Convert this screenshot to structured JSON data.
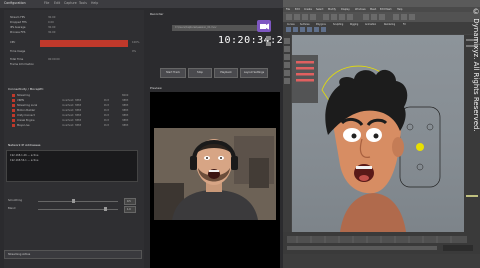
{
  "recorder_app": {
    "window_title": "Configuration",
    "tabs": [
      "File",
      "Edit",
      "Capture",
      "Tools",
      "Help"
    ],
    "config_rows": [
      {
        "label": "Stream FPS",
        "value": "30.00"
      },
      {
        "label": "Dropped FPS",
        "value": "0.00"
      },
      {
        "label": "IPS Average",
        "value": "30.00"
      },
      {
        "label": "Process FPS",
        "value": "30.00"
      },
      {
        "label": "CPU",
        "value": "100%"
      },
      {
        "label": "Time Usage",
        "value": "0%"
      },
      {
        "label": "Total Time",
        "value": "00:00:00"
      },
      {
        "label": "Frame Information",
        "value": ""
      }
    ],
    "cpu_percent": 100,
    "streaming_header": "Connectivity / MocapPC",
    "services": [
      {
        "name": "Streaming",
        "addr": "",
        "proto": "Port",
        "port": "8000"
      },
      {
        "name": "VRPN",
        "addr": "localhost: 3883",
        "proto": "Port",
        "port": "3883"
      },
      {
        "name": "Streaming Local",
        "addr": "localhost: 3883",
        "proto": "Port",
        "port": "3883"
      },
      {
        "name": "Motion Builder",
        "addr": "localhost: 3883",
        "proto": "Port",
        "port": "3883"
      },
      {
        "name": "Unity Connect",
        "addr": "localhost: 3883",
        "proto": "Port",
        "port": "3883"
      },
      {
        "name": "Unreal Engine",
        "addr": "localhost: 3883",
        "proto": "Port",
        "port": "3883"
      },
      {
        "name": "Maya Live",
        "addr": "localhost: 3883",
        "proto": "Port",
        "port": "3883"
      }
    ],
    "ip_header": "Network IP Addresses",
    "ip_lines": [
      "192.168.1.46  —  active",
      "192.168.56.1  —  active"
    ],
    "smoothing_label": "Smoothing",
    "smoothing_value": "0.5",
    "blend_label": "Blend",
    "blend_value": "1.0",
    "bottom_status": "Streaming Active",
    "recorder_label": "Recorder",
    "recorder_path": "C:\\Users\\Captures\\session_01.mov",
    "timecode": "10:20:34:23",
    "buttons": {
      "rec": "Start Track",
      "stop": "Stop",
      "prev": "Playback",
      "settings": "Layout Settings"
    },
    "preview_label": "Preview",
    "icons": {
      "recorder_icon": "camera-icon"
    },
    "accent_color": "#c0392b",
    "rec_color": "#7e57c2"
  },
  "maya_app": {
    "menus": [
      "File",
      "Edit",
      "Create",
      "Select",
      "Modify",
      "Display",
      "Windows",
      "Mesh",
      "Edit Mesh",
      "Help"
    ],
    "shelf_tabs": [
      "Curves",
      "Surfaces",
      "Polygons",
      "Sculpting",
      "Rigging",
      "Animation",
      "Rendering",
      "FX"
    ],
    "watermark": "© Dynamixyz. All Rights Reserved."
  }
}
